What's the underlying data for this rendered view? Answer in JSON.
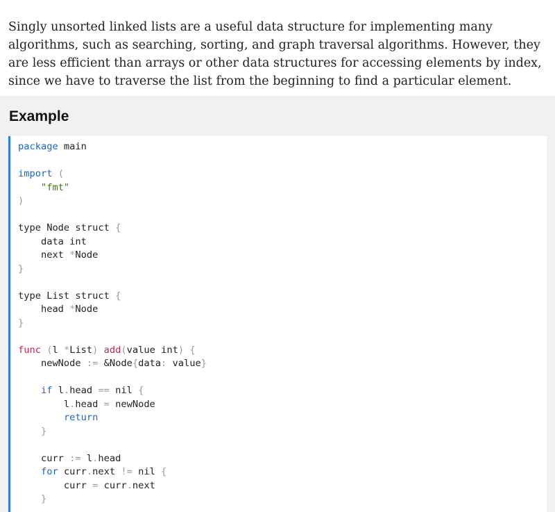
{
  "intro": {
    "text": "Singly unsorted linked lists are a useful data structure for implementing many algorithms, such as searching, sorting, and graph traversal algorithms. However, they are less efficient than arrays or other data structures for accessing elements by index, since we have to traverse the list from the beginning to find a particular element."
  },
  "example": {
    "heading": "Example",
    "language": "go",
    "colors": {
      "accent_bar": "#2b7de9",
      "keyword": "#1f64c8",
      "string": "#3c7a10",
      "function": "#c7254e",
      "punctuation": "#9a9a9a",
      "panel_background": "#f1f1f1"
    },
    "code_lines": [
      [
        [
          "kw",
          "package"
        ],
        [
          "plain",
          " main"
        ]
      ],
      [],
      [
        [
          "kw",
          "import"
        ],
        [
          "plain",
          " "
        ],
        [
          "punc",
          "("
        ]
      ],
      [
        [
          "plain",
          "    "
        ],
        [
          "str",
          "\"fmt\""
        ]
      ],
      [
        [
          "punc",
          ")"
        ]
      ],
      [],
      [
        [
          "plain",
          "type Node struct "
        ],
        [
          "punc",
          "{"
        ]
      ],
      [
        [
          "plain",
          "    data int"
        ]
      ],
      [
        [
          "plain",
          "    next "
        ],
        [
          "punc",
          "*"
        ],
        [
          "plain",
          "Node"
        ]
      ],
      [
        [
          "punc",
          "}"
        ]
      ],
      [],
      [
        [
          "plain",
          "type List struct "
        ],
        [
          "punc",
          "{"
        ]
      ],
      [
        [
          "plain",
          "    head "
        ],
        [
          "punc",
          "*"
        ],
        [
          "plain",
          "Node"
        ]
      ],
      [
        [
          "punc",
          "}"
        ]
      ],
      [],
      [
        [
          "fn",
          "func"
        ],
        [
          "plain",
          " "
        ],
        [
          "punc",
          "("
        ],
        [
          "plain",
          "l "
        ],
        [
          "punc",
          "*"
        ],
        [
          "plain",
          "List"
        ],
        [
          "punc",
          ")"
        ],
        [
          "plain",
          " "
        ],
        [
          "fn",
          "add"
        ],
        [
          "punc",
          "("
        ],
        [
          "plain",
          "value int"
        ],
        [
          "punc",
          ")"
        ],
        [
          "plain",
          " "
        ],
        [
          "punc",
          "{"
        ]
      ],
      [
        [
          "plain",
          "    newNode "
        ],
        [
          "punc",
          ":="
        ],
        [
          "plain",
          " &Node"
        ],
        [
          "punc",
          "{"
        ],
        [
          "plain",
          "data"
        ],
        [
          "punc",
          ":"
        ],
        [
          "plain",
          " value"
        ],
        [
          "punc",
          "}"
        ]
      ],
      [],
      [
        [
          "plain",
          "    "
        ],
        [
          "kw",
          "if"
        ],
        [
          "plain",
          " l"
        ],
        [
          "punc",
          "."
        ],
        [
          "plain",
          "head "
        ],
        [
          "punc",
          "=="
        ],
        [
          "plain",
          " nil "
        ],
        [
          "punc",
          "{"
        ]
      ],
      [
        [
          "plain",
          "        l"
        ],
        [
          "punc",
          "."
        ],
        [
          "plain",
          "head "
        ],
        [
          "punc",
          "="
        ],
        [
          "plain",
          " newNode"
        ]
      ],
      [
        [
          "plain",
          "        "
        ],
        [
          "kw",
          "return"
        ]
      ],
      [
        [
          "plain",
          "    "
        ],
        [
          "punc",
          "}"
        ]
      ],
      [],
      [
        [
          "plain",
          "    curr "
        ],
        [
          "punc",
          ":="
        ],
        [
          "plain",
          " l"
        ],
        [
          "punc",
          "."
        ],
        [
          "plain",
          "head"
        ]
      ],
      [
        [
          "plain",
          "    "
        ],
        [
          "kw",
          "for"
        ],
        [
          "plain",
          " curr"
        ],
        [
          "punc",
          "."
        ],
        [
          "plain",
          "next "
        ],
        [
          "punc",
          "!="
        ],
        [
          "plain",
          " nil "
        ],
        [
          "punc",
          "{"
        ]
      ],
      [
        [
          "plain",
          "        curr "
        ],
        [
          "punc",
          "="
        ],
        [
          "plain",
          " curr"
        ],
        [
          "punc",
          "."
        ],
        [
          "plain",
          "next"
        ]
      ],
      [
        [
          "plain",
          "    "
        ],
        [
          "punc",
          "}"
        ]
      ]
    ]
  }
}
